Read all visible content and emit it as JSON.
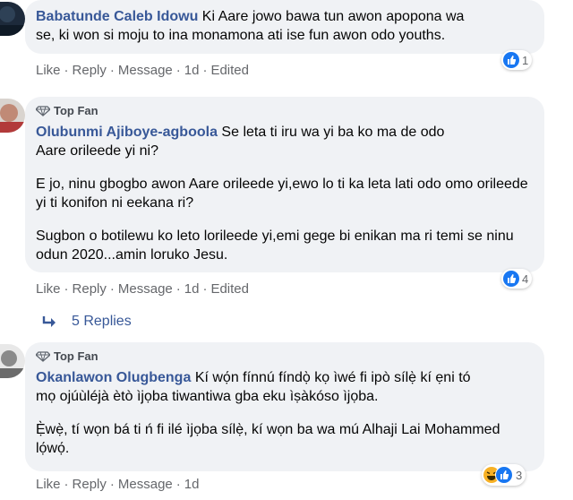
{
  "comments": [
    {
      "author": "Babatunde Caleb Idowu",
      "top_fan": "",
      "text_first": "Ki Aare jowo bawa tun awon apopona wa",
      "text_rest": "se, ki won si moju to ina monamona ati ise fun awon odo youths.",
      "actions": {
        "like": "Like",
        "reply": "Reply",
        "message": "Message",
        "time": "1d",
        "edited": "Edited"
      },
      "reaction_count": "1"
    },
    {
      "author": "Olubunmi Ajiboye-agboola",
      "top_fan": "Top Fan",
      "text_first": "Se leta ti iru wa yi ba ko ma de odo",
      "text_rest": "Aare orileede yi ni?",
      "para2": "E jo, ninu gbogbo awon Aare orileede yi,ewo lo ti ka leta lati odo omo orileede yi ti konifon ni eekana ri?",
      "para3": "Sugbon o botilewu ko leto lorileede yi,emi gege bi enikan ma ri temi se ninu odun 2020...amin loruko Jesu.",
      "actions": {
        "like": "Like",
        "reply": "Reply",
        "message": "Message",
        "time": "1d",
        "edited": "Edited"
      },
      "reaction_count": "4",
      "replies_label": "5 Replies"
    },
    {
      "author": "Okanlawon Olugbenga",
      "top_fan": "Top Fan",
      "text_first": "Kí wọ́n fínnú fíndọ̀ kọ ìwé fi ipò sílẹ̀ kí ẹni tó",
      "text_rest": "mọ ojúùléjà ètò ìjọba tiwantiwa gba eku ìṣàkóso ìjọba.",
      "para2": "Ẹ̀wẹ̀, tí wọn bá ti ń fi ilé ìjọba sílẹ̀, kí wọn ba wa mú Alhaji Lai Mohammed lọ́wọ́.",
      "actions": {
        "like": "Like",
        "reply": "Reply",
        "message": "Message",
        "time": "1d"
      },
      "reaction_count": "3"
    }
  ]
}
